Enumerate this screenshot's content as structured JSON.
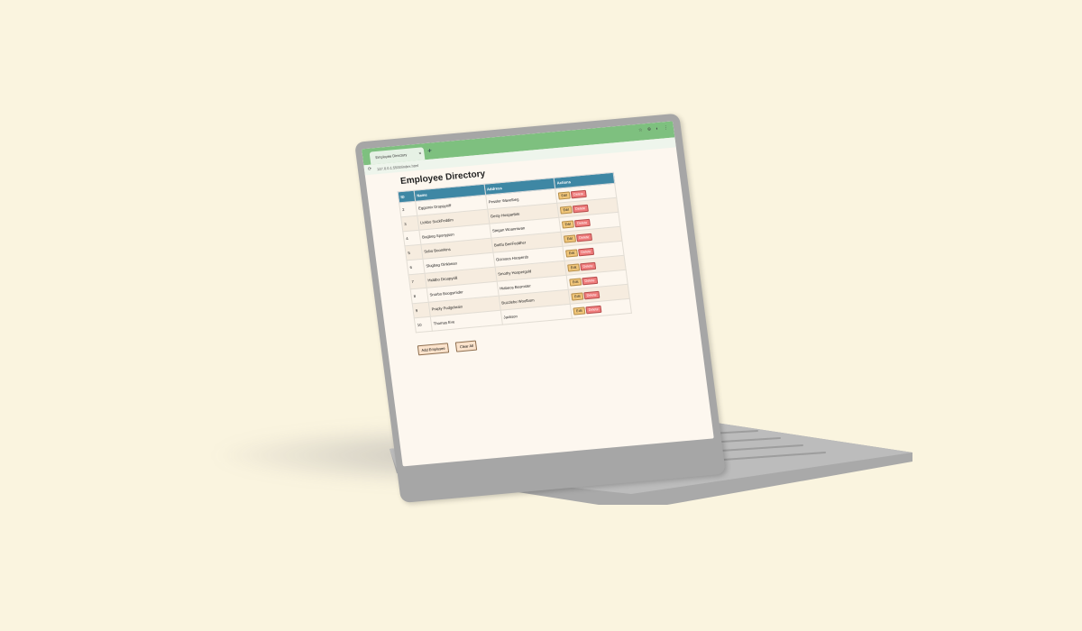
{
  "browser": {
    "tab_title": "Employee Directory",
    "new_tab": "+",
    "close_tab": "×",
    "url": "127.0.0.1:5500/index.html",
    "toolbar_icons": "☆ ⊕ ◐ ⋮"
  },
  "page": {
    "title": "Employee Directory"
  },
  "table": {
    "headers": [
      "ID",
      "Name",
      "Address",
      "Actions"
    ],
    "rows": [
      {
        "id": "2",
        "name": "Eggsmix Droppyniff",
        "address": "Pessler Wavelbeg"
      },
      {
        "id": "3",
        "name": "Lickbo SockFeddim",
        "address": "Gesty Hospartbte"
      },
      {
        "id": "4",
        "name": "Bugbeg Sportyjson",
        "address": "Stegan Woanniwan"
      },
      {
        "id": "5",
        "name": "Subo Boomkins",
        "address": "Bottfu BeeFeddher"
      },
      {
        "id": "6",
        "name": "Slugbag Oinkbean",
        "address": "Gizmoes Hoopersb"
      },
      {
        "id": "7",
        "name": "Hiddbo Droopysill",
        "address": "Smothy Hoopergold"
      },
      {
        "id": "8",
        "name": "Snorbo Boogsmider",
        "address": "Hiabeos Beomster"
      },
      {
        "id": "9",
        "name": "Proply Fudgebrain",
        "address": "Buzzlebo Woofbom"
      },
      {
        "id": "10",
        "name": "Thomas Eve",
        "address": "Jackson"
      }
    ],
    "edit_label": "Edit",
    "delete_label": "Delete"
  },
  "actions": {
    "add_label": "Add Employee",
    "clear_label": "Clear All"
  },
  "colors": {
    "background": "#faf4df",
    "tabbar": "#7ec07f",
    "table_header": "#3e87a4",
    "edit_button": "#f2c77a",
    "delete_button": "#ef7c7c"
  }
}
